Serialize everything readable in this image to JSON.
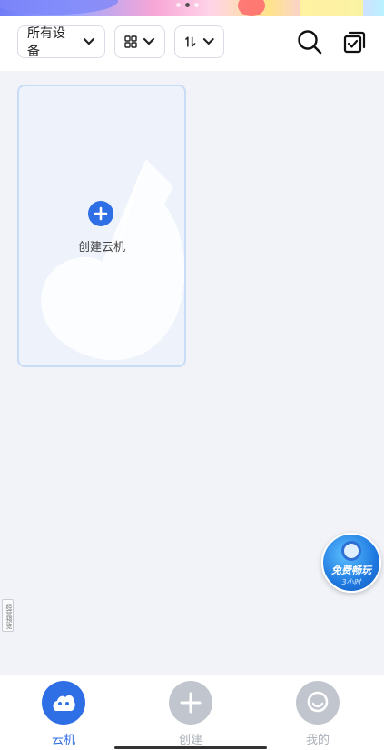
{
  "banner": {
    "active_dot": 1
  },
  "toolbar": {
    "device_filter_label": "所有设备",
    "view_icon": "grid-icon",
    "sort_icon": "sort-icon",
    "search_icon": "search-icon",
    "multi_select_icon": "multi-select-icon"
  },
  "create_card": {
    "label": "创建云机",
    "icon": "plus-circle-icon"
  },
  "promo": {
    "title": "免费畅玩",
    "subtitle": "3小时"
  },
  "side_tab": {
    "text": "经营预览"
  },
  "bottom_nav": {
    "items": [
      {
        "label": "云机",
        "icon": "cloud-phone-icon",
        "active": true
      },
      {
        "label": "创建",
        "icon": "plus-icon",
        "active": false
      },
      {
        "label": "我的",
        "icon": "profile-icon",
        "active": false
      }
    ]
  },
  "colors": {
    "accent": "#2f6fe6",
    "background": "#f1f3f8",
    "inactive": "#c1c6ce"
  }
}
